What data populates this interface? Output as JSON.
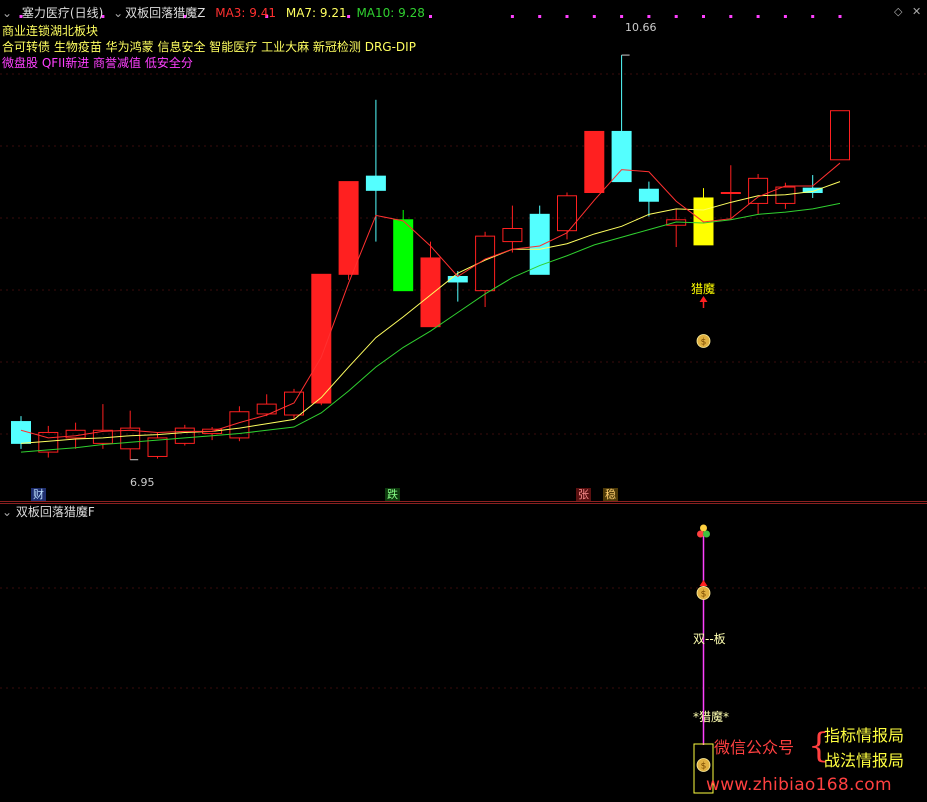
{
  "header": {
    "stock_name": "塞力医疗",
    "period": "(日线)",
    "indicator": "双板回落猎魔Z",
    "ma3_label": "MA3: 9.41",
    "ma7_label": "MA7: 9.21",
    "ma10_label": "MA10: 9.28"
  },
  "concepts": {
    "line1": "商业连锁湖北板块",
    "line2": "合可转债 生物疫苗 华为鸿蒙 信息安全 智能医疗 工业大麻 新冠检测 DRG-DIP",
    "line3": "微盘股 QFII新进 商誉减值 低安全分"
  },
  "annotations": {
    "high_label": "10.66",
    "low_label": "6.95",
    "signal_label": "猎魔",
    "badge_cai": "财",
    "badge_die": "跌",
    "badge_zhang": "张",
    "badge_wen": "稳"
  },
  "sub_panel": {
    "title": "双板回落猎魔F",
    "label_double": "双--板",
    "label_hunt": "*猎魔*"
  },
  "watermark": {
    "wechat": "微信公众号",
    "name1": "指标情报局",
    "name2": "战法情报局",
    "url": "www.zhibiao168.com"
  },
  "colors": {
    "up": "#ff2020",
    "down": "#54ffff",
    "ma3": "#ff3030",
    "ma7": "#ffff60",
    "ma10": "#30d030",
    "signal": "#ffff00",
    "limit_down": "#00ff00",
    "magenta": "#ff40ff"
  },
  "chart_data": {
    "type": "candlestick",
    "ylim": [
      6.7,
      11.0
    ],
    "candles": [
      {
        "o": 7.3,
        "h": 7.35,
        "l": 7.05,
        "c": 7.1,
        "hl": false
      },
      {
        "o": 7.02,
        "h": 7.26,
        "l": 6.97,
        "c": 7.2,
        "hl": false
      },
      {
        "o": 7.15,
        "h": 7.29,
        "l": 7.05,
        "c": 7.22,
        "hl": false
      },
      {
        "o": 7.1,
        "h": 7.46,
        "l": 7.05,
        "c": 7.22,
        "hl": false
      },
      {
        "o": 7.05,
        "h": 7.4,
        "l": 6.95,
        "c": 7.24,
        "hl": false
      },
      {
        "o": 6.98,
        "h": 7.2,
        "l": 6.96,
        "c": 7.15,
        "hl": false
      },
      {
        "o": 7.1,
        "h": 7.27,
        "l": 7.08,
        "c": 7.24,
        "hl": false
      },
      {
        "o": 7.19,
        "h": 7.25,
        "l": 7.13,
        "c": 7.23,
        "hl": false
      },
      {
        "o": 7.15,
        "h": 7.44,
        "l": 7.12,
        "c": 7.39,
        "hl": false
      },
      {
        "o": 7.37,
        "h": 7.55,
        "l": 7.35,
        "c": 7.46,
        "hl": false
      },
      {
        "o": 7.36,
        "h": 7.6,
        "l": 7.32,
        "c": 7.57,
        "hl": false
      },
      {
        "o": 7.47,
        "h": 8.65,
        "l": 7.45,
        "c": 8.65,
        "hl": false
      },
      {
        "o": 8.65,
        "h": 9.5,
        "l": 8.6,
        "c": 9.5,
        "hl": false
      },
      {
        "o": 9.55,
        "h": 10.25,
        "l": 8.95,
        "c": 9.42,
        "hl": false
      },
      {
        "o": 9.15,
        "h": 9.24,
        "l": 8.5,
        "c": 8.5,
        "hl": "limit"
      },
      {
        "o": 8.17,
        "h": 8.95,
        "l": 8.17,
        "c": 8.8,
        "hl": false
      },
      {
        "o": 8.63,
        "h": 8.68,
        "l": 8.4,
        "c": 8.58,
        "hl": false
      },
      {
        "o": 8.5,
        "h": 9.04,
        "l": 8.35,
        "c": 9.0,
        "hl": false
      },
      {
        "o": 8.95,
        "h": 9.28,
        "l": 8.85,
        "c": 9.07,
        "hl": false
      },
      {
        "o": 9.2,
        "h": 9.28,
        "l": 8.65,
        "c": 8.65,
        "hl": false
      },
      {
        "o": 9.05,
        "h": 9.4,
        "l": 8.97,
        "c": 9.37,
        "hl": false
      },
      {
        "o": 9.4,
        "h": 9.96,
        "l": 9.4,
        "c": 9.96,
        "hl": false
      },
      {
        "o": 9.96,
        "h": 10.66,
        "l": 9.5,
        "c": 9.5,
        "hl": false
      },
      {
        "o": 9.43,
        "h": 9.5,
        "l": 9.18,
        "c": 9.32,
        "hl": false
      },
      {
        "o": 9.1,
        "h": 9.25,
        "l": 8.9,
        "c": 9.15,
        "hl": false
      },
      {
        "o": 9.35,
        "h": 9.44,
        "l": 8.92,
        "c": 8.92,
        "hl": "signal"
      },
      {
        "o": 9.4,
        "h": 9.65,
        "l": 9.15,
        "c": 9.4,
        "hl": false
      },
      {
        "o": 9.3,
        "h": 9.57,
        "l": 9.2,
        "c": 9.53,
        "hl": false
      },
      {
        "o": 9.3,
        "h": 9.49,
        "l": 9.25,
        "c": 9.45,
        "hl": false
      },
      {
        "o": 9.44,
        "h": 9.56,
        "l": 9.35,
        "c": 9.4,
        "hl": false
      },
      {
        "o": 9.7,
        "h": 10.15,
        "l": 9.7,
        "c": 10.15,
        "hl": false
      }
    ],
    "ma3": [
      7.22,
      7.15,
      7.17,
      7.21,
      7.22,
      7.2,
      7.21,
      7.21,
      7.29,
      7.36,
      7.47,
      7.89,
      8.57,
      9.19,
      9.14,
      8.91,
      8.63,
      8.79,
      8.88,
      8.91,
      9.03,
      9.33,
      9.61,
      9.59,
      9.32,
      9.13,
      9.16,
      9.36,
      9.46,
      9.46,
      9.67
    ],
    "ma7": [
      7.1,
      7.12,
      7.14,
      7.15,
      7.17,
      7.18,
      7.2,
      7.21,
      7.24,
      7.28,
      7.32,
      7.52,
      7.8,
      8.07,
      8.26,
      8.46,
      8.66,
      8.78,
      8.88,
      8.88,
      8.93,
      9.02,
      9.09,
      9.2,
      9.25,
      9.24,
      9.31,
      9.37,
      9.38,
      9.41,
      9.5
    ],
    "ma10": [
      7.02,
      7.04,
      7.06,
      7.09,
      7.11,
      7.13,
      7.15,
      7.17,
      7.19,
      7.22,
      7.25,
      7.38,
      7.58,
      7.8,
      7.98,
      8.13,
      8.3,
      8.47,
      8.62,
      8.73,
      8.82,
      8.92,
      8.99,
      9.06,
      9.13,
      9.12,
      9.15,
      9.2,
      9.22,
      9.25,
      9.3
    ]
  }
}
